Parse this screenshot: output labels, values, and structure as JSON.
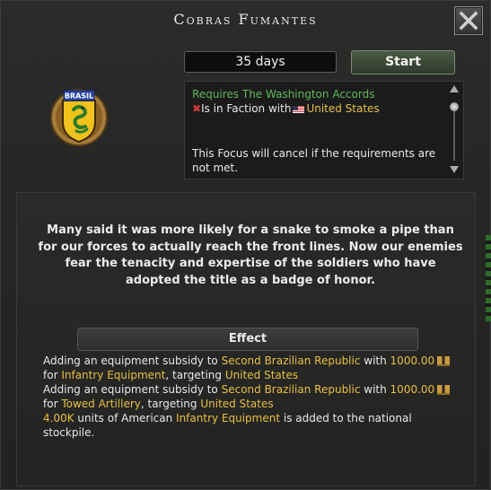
{
  "window": {
    "title": "Cobras Fumantes"
  },
  "header": {
    "duration": "35 days",
    "start_label": "Start"
  },
  "emblem": {
    "text": "BRASIL"
  },
  "requirements": {
    "title": "Requires The Washington Accords",
    "condition_prefix": "Is in Faction with",
    "country": "United States",
    "cancel_note": "This Focus will cancel if the requirements are not met."
  },
  "description": "Many said it was more likely for a snake to smoke a pipe than for our forces to actually reach the front lines. Now our enemies fear the tenacity and expertise of the soldiers who have adopted the title as a badge of honor.",
  "effect": {
    "header": "Effect",
    "lines": [
      {
        "a": "Adding an equipment subsidy to ",
        "b": "Second Brazilian Republic",
        "c": " with ",
        "d": "1000.00"
      },
      {
        "a": "for ",
        "b": "Infantry Equipment",
        "c": ", targeting ",
        "d": "United States"
      },
      {
        "a": "Adding an equipment subsidy to ",
        "b": "Second Brazilian Republic",
        "c": " with ",
        "d": "1000.00"
      },
      {
        "a": "for ",
        "b": "Towed Artillery",
        "c": ", targeting ",
        "d": "United States"
      },
      {
        "a": "4.00K",
        "b": " units of American ",
        "c": "Infantry Equipment",
        "d": " is added to the national"
      },
      {
        "a": "stockpile."
      }
    ]
  },
  "colors": {
    "accent_gold": "#e7c042",
    "requirement_green": "#5fb85a",
    "fail_red": "#d23a3a"
  },
  "icons": [
    "close-icon",
    "focus-emblem-icon",
    "cross-icon",
    "us-flag-icon",
    "political-power-icon"
  ]
}
